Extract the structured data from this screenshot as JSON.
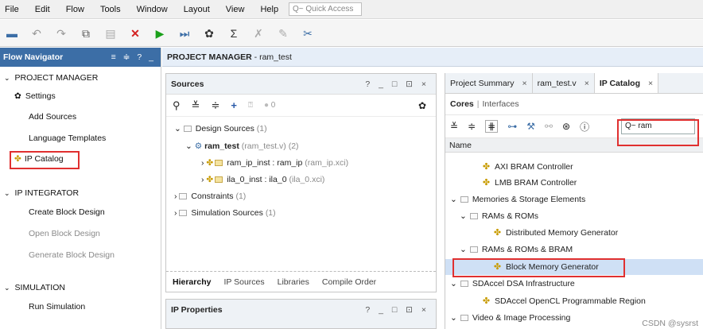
{
  "menu": {
    "items": [
      "File",
      "Edit",
      "Flow",
      "Tools",
      "Window",
      "Layout",
      "View",
      "Help"
    ],
    "quick_access_placeholder": "Q~ Quick Access"
  },
  "toolbar": {
    "icons": [
      "open-project-icon",
      "undo-icon",
      "redo-icon",
      "copy-icon",
      "paste-icon",
      "delete-icon",
      "run-icon",
      "step-icon",
      "settings-icon",
      "sum-icon",
      "autoconnect-icon",
      "pen-icon",
      "cut-icon"
    ]
  },
  "flow_navigator": {
    "title": "Flow Navigator",
    "controls": "≡ ≑ ? _",
    "sections": [
      {
        "label": "PROJECT MANAGER",
        "items": [
          "Settings",
          "Add Sources",
          "Language Templates",
          "IP Catalog"
        ]
      },
      {
        "label": "IP INTEGRATOR",
        "items": [
          "Create Block Design",
          "Open Block Design",
          "Generate Block Design"
        ]
      },
      {
        "label": "SIMULATION",
        "items": [
          "Run Simulation"
        ]
      }
    ]
  },
  "pm_header": {
    "bold": "PROJECT MANAGER",
    "rest": " - ram_test"
  },
  "sources": {
    "title": "Sources",
    "controls": "? _ □ ⊡ ×",
    "count_badge": "0",
    "tree": {
      "design_sources": "Design Sources",
      "design_sources_count": "(1)",
      "top_name": "ram_test",
      "top_file": "(ram_test.v) (2)",
      "child1_name": "ram_ip_inst : ram_ip",
      "child1_file": "(ram_ip.xci)",
      "child2_name": "ila_0_inst : ila_0",
      "child2_file": "(ila_0.xci)",
      "constraints": "Constraints",
      "constraints_count": "(1)",
      "sim_sources": "Simulation Sources",
      "sim_sources_count": "(1)"
    },
    "bottom_tabs": [
      "Hierarchy",
      "IP Sources",
      "Libraries",
      "Compile Order"
    ]
  },
  "ip_properties": {
    "title": "IP Properties",
    "controls": "? _ □ ⊡ ×"
  },
  "right_panel": {
    "tabs": [
      {
        "label": "Project Summary",
        "close": "×"
      },
      {
        "label": "ram_test.v",
        "close": "×"
      },
      {
        "label": "IP Catalog",
        "close": "×"
      }
    ],
    "subtabs": {
      "active": "Cores",
      "other": "Interfaces"
    },
    "search_value": "Q~ ram",
    "column_header": "Name",
    "rows": [
      {
        "label": "AXI BRAM Controller",
        "type": "ip"
      },
      {
        "label": "LMB BRAM Controller",
        "type": "ip"
      },
      {
        "label": "Memories & Storage Elements",
        "type": "folder"
      },
      {
        "label": "RAMs & ROMs",
        "type": "folder"
      },
      {
        "label": "Distributed Memory Generator",
        "type": "ip"
      },
      {
        "label": "RAMs & ROMs & BRAM",
        "type": "folder"
      },
      {
        "label": "Block Memory Generator",
        "type": "ip"
      },
      {
        "label": "SDAccel DSA Infrastructure",
        "type": "folder"
      },
      {
        "label": "SDAccel OpenCL Programmable Region",
        "type": "ip"
      },
      {
        "label": "Video & Image Processing",
        "type": "folder"
      }
    ]
  },
  "watermark": "CSDN @sysrst",
  "colors": {
    "accent": "#3c6ea6",
    "highlight_box": "#e03030",
    "selection": "#cfe0f5"
  }
}
